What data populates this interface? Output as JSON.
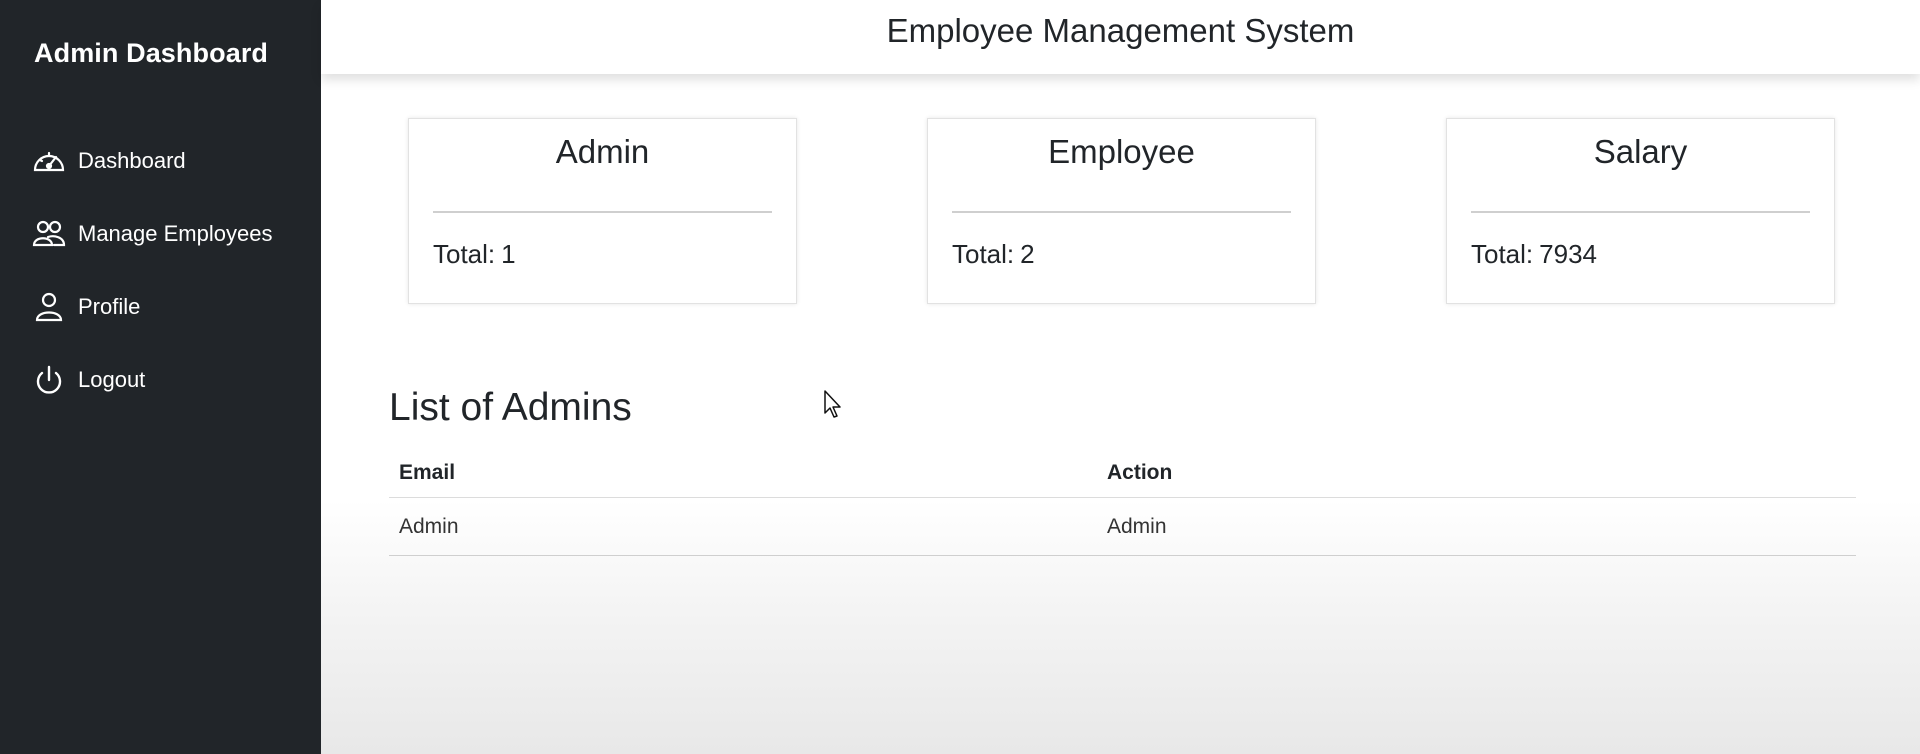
{
  "sidebar": {
    "brand": "Admin Dashboard",
    "items": [
      {
        "label": "Dashboard",
        "icon": "speedometer-icon"
      },
      {
        "label": "Manage Employees",
        "icon": "people-icon"
      },
      {
        "label": "Profile",
        "icon": "person-icon"
      },
      {
        "label": "Logout",
        "icon": "power-icon"
      }
    ]
  },
  "header": {
    "title": "Employee Management System"
  },
  "cards": [
    {
      "title": "Admin",
      "total_label": "Total:",
      "total_value": "1"
    },
    {
      "title": "Employee",
      "total_label": "Total:",
      "total_value": "2"
    },
    {
      "title": "Salary",
      "total_label": "Total:",
      "total_value": "7934"
    }
  ],
  "admins": {
    "title": "List of Admins",
    "columns": [
      "Email",
      "Action"
    ],
    "rows": [
      [
        "Admin",
        "Admin"
      ]
    ]
  },
  "colors": {
    "sidebar_bg": "#212529",
    "text": "#212529"
  }
}
